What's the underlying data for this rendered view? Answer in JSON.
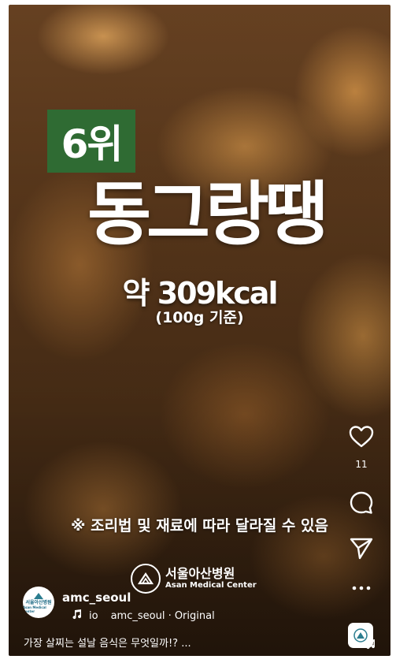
{
  "overlay": {
    "rank": "6위",
    "dish_name": "동그랑땡",
    "calories": "약 309kcal",
    "basis": "(100g 기준)",
    "notice": "※ 조리법 및 재료에 따라 달라질 수 있음",
    "watermark_kr": "서울아산병원",
    "watermark_en": "Asan Medical Center"
  },
  "actions": {
    "like_icon": "heart-icon",
    "like_count": "11",
    "comment_icon": "comment-icon",
    "share_icon": "send-icon",
    "more_icon": "more-icon"
  },
  "author": {
    "username": "amc_seoul",
    "avatar_text": "서울아산병원",
    "avatar_sub": "Asan Medical Center"
  },
  "audio": {
    "icon": "music-note-icon",
    "ticker": "io",
    "source": "amc_seoul · Original"
  },
  "caption": "가장 살찌는 설날 음식은 무엇일까!? ...",
  "colors": {
    "badge": "#2f6b33",
    "text": "#ffffff"
  }
}
